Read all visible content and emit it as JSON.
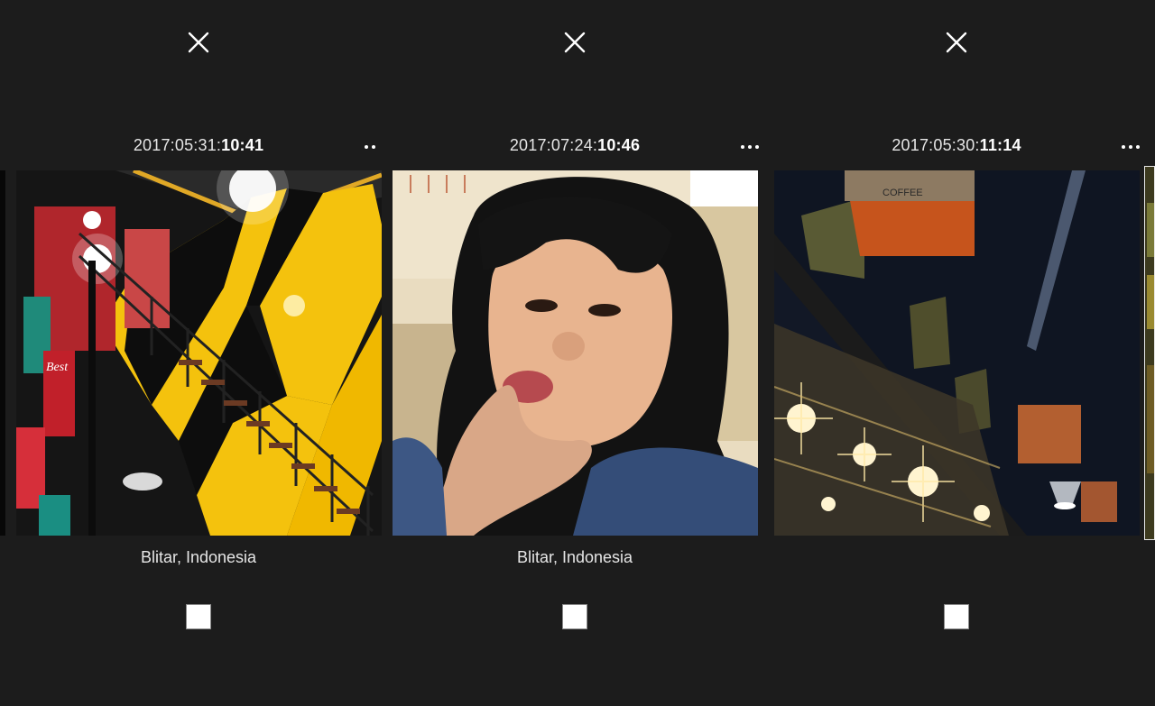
{
  "panels": [
    {
      "date": "2017:05:31:",
      "time": "10:41",
      "location": "Blitar, Indonesia",
      "photo_icon": "stairway-photo",
      "more_icon": "two-dots-icon"
    },
    {
      "date": "2017:07:24:",
      "time": "10:46",
      "location": "Blitar, Indonesia",
      "photo_icon": "selfie-photo",
      "more_icon": "three-dots-icon"
    },
    {
      "date": "2017:05:30:",
      "time": "11:14",
      "location": "",
      "photo_icon": "cafe-ceiling-photo",
      "more_icon": "three-dots-icon"
    }
  ],
  "colors": {
    "background": "#1c1c1c",
    "text": "#e6e6e6",
    "accent_yellow": "#f4c20d"
  }
}
